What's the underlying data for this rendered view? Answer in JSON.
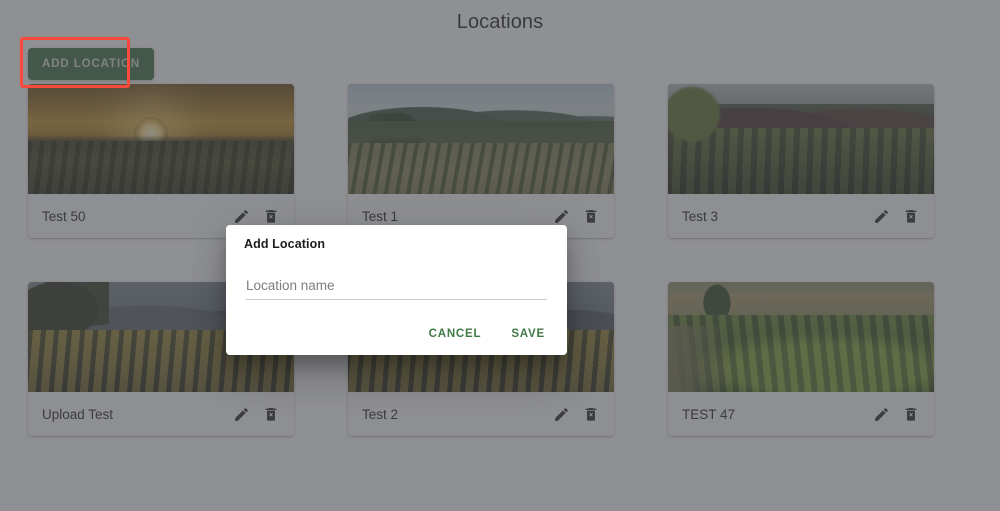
{
  "page": {
    "title": "Locations",
    "background_color": "#7c7d80",
    "accent_color": "#38693f"
  },
  "toolbar": {
    "add_location_label": "ADD LOCATION"
  },
  "highlight": {
    "color": "#fb4a3b",
    "target": "ADD LOCATION"
  },
  "cards": [
    {
      "label": "Test 50",
      "scene": "sunset vineyard",
      "edit_icon": "pencil-icon",
      "delete_icon": "trash-icon"
    },
    {
      "label": "Test 1",
      "scene": "green valley vineyard",
      "edit_icon": "pencil-icon",
      "delete_icon": "trash-icon"
    },
    {
      "label": "Test 3",
      "scene": "dark mountain vineyard",
      "edit_icon": "pencil-icon",
      "delete_icon": "trash-icon"
    },
    {
      "label": "Upload Test",
      "scene": "autumn hillside vineyard",
      "edit_icon": "pencil-icon",
      "delete_icon": "trash-icon"
    },
    {
      "label": "Test 2",
      "scene": "vineyard rows",
      "edit_icon": "pencil-icon",
      "delete_icon": "trash-icon"
    },
    {
      "label": "TEST 47",
      "scene": "leafy vine rows",
      "edit_icon": "pencil-icon",
      "delete_icon": "trash-icon"
    }
  ],
  "dialog": {
    "title": "Add Location",
    "input": {
      "placeholder": "Location name",
      "value": ""
    },
    "cancel_label": "CANCEL",
    "save_label": "SAVE",
    "button_color": "#3f7a46"
  }
}
